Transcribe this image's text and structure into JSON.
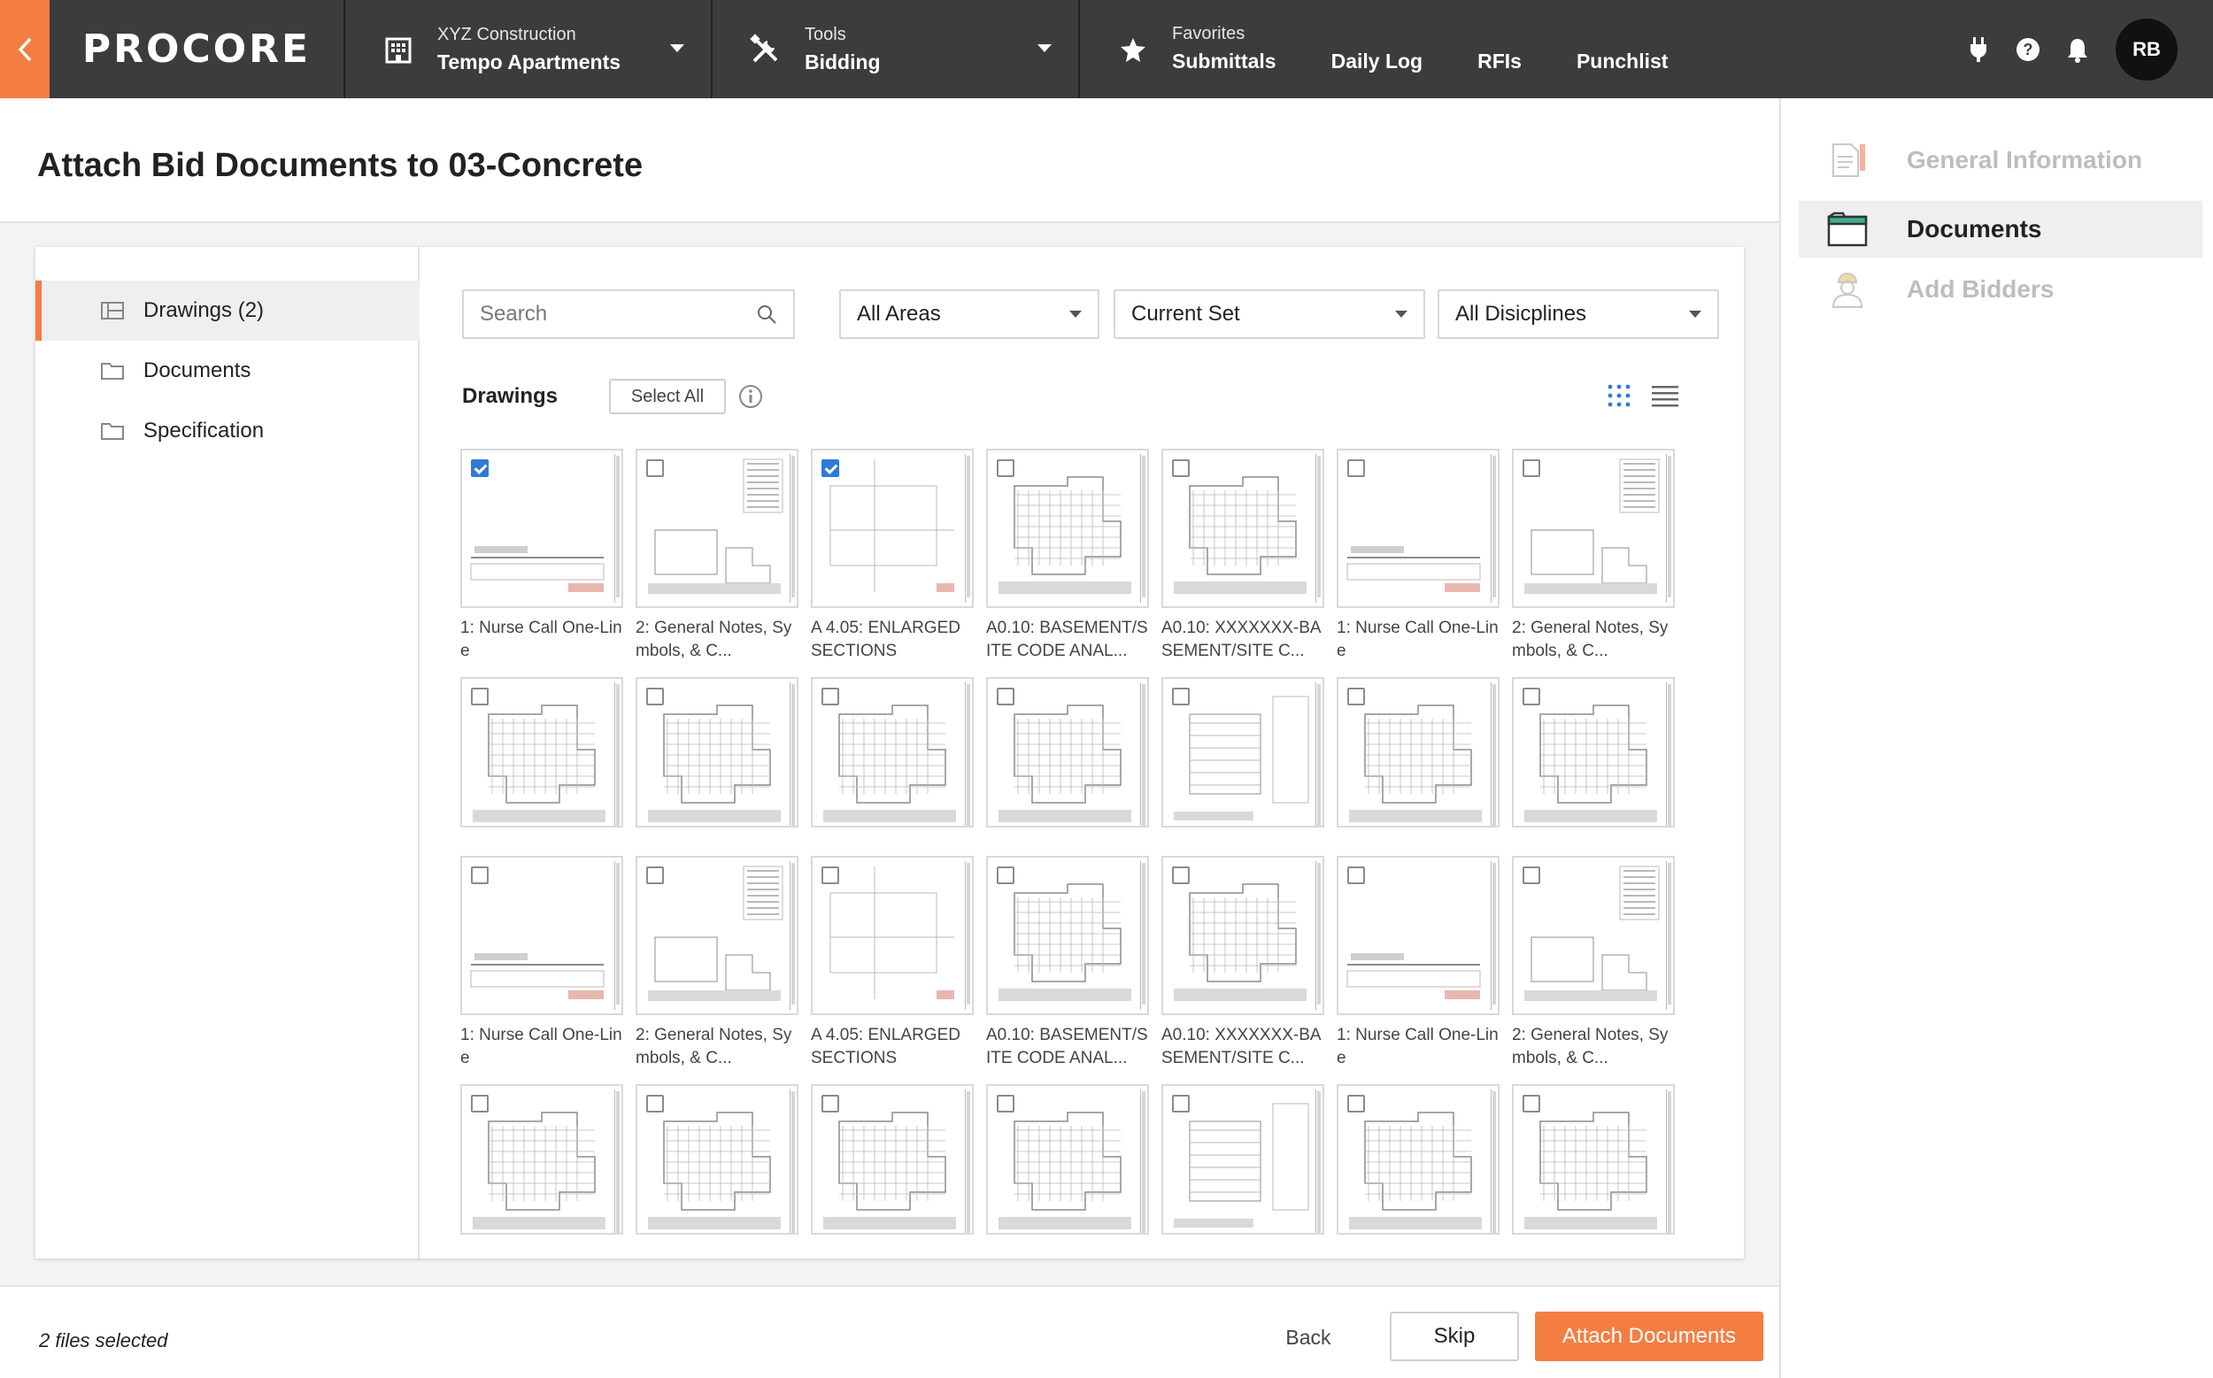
{
  "topbar": {
    "logo": "PROCORE",
    "project": {
      "company": "XYZ Construction",
      "name": "Tempo Apartments"
    },
    "tools": {
      "label": "Tools",
      "current": "Bidding"
    },
    "favorites": {
      "label": "Favorites",
      "links": [
        "Submittals",
        "Daily Log",
        "RFIs",
        "Punchlist"
      ]
    },
    "icons": [
      "plug-icon",
      "help-icon",
      "bell-icon"
    ],
    "avatar": "RB",
    "accent": "#f47e42"
  },
  "page": {
    "title": "Attach Bid Documents to 03-Concrete"
  },
  "sidebar": {
    "items": [
      {
        "label": "Drawings (2)",
        "icon": "drawings-icon",
        "active": true
      },
      {
        "label": "Documents",
        "icon": "folder-icon",
        "active": false
      },
      {
        "label": "Specification",
        "icon": "folder-icon",
        "active": false
      }
    ]
  },
  "filters": {
    "search_placeholder": "Search",
    "areas": "All Areas",
    "set": "Current Set",
    "disciplines": "All Disicplines"
  },
  "drawings": {
    "section_label": "Drawings",
    "select_all": "Select All",
    "items": [
      {
        "caption": "1: Nurse Call One-Line",
        "checked": true,
        "kind": "a"
      },
      {
        "caption": "2: General Notes, Symbols, & C...",
        "checked": false,
        "kind": "b"
      },
      {
        "caption": "A 4.05: ENLARGED SECTIONS",
        "checked": true,
        "kind": "c"
      },
      {
        "caption": "A0.10: BASEMENT/SITE CODE ANAL...",
        "checked": false,
        "kind": "d"
      },
      {
        "caption": "A0.10: XXXXXXX-BASEMENT/SITE C...",
        "checked": false,
        "kind": "d"
      },
      {
        "caption": "1: Nurse Call One-Line",
        "checked": false,
        "kind": "a"
      },
      {
        "caption": "2: General Notes, Symbols, & C...",
        "checked": false,
        "kind": "b"
      },
      {
        "caption": "",
        "checked": false,
        "kind": "d"
      },
      {
        "caption": "",
        "checked": false,
        "kind": "d"
      },
      {
        "caption": "",
        "checked": false,
        "kind": "d"
      },
      {
        "caption": "",
        "checked": false,
        "kind": "d"
      },
      {
        "caption": "",
        "checked": false,
        "kind": "e"
      },
      {
        "caption": "",
        "checked": false,
        "kind": "d"
      },
      {
        "caption": "",
        "checked": false,
        "kind": "d"
      },
      {
        "caption": "1: Nurse Call One-Line",
        "checked": false,
        "kind": "a"
      },
      {
        "caption": "2: General Notes, Symbols, & C...",
        "checked": false,
        "kind": "b"
      },
      {
        "caption": "A 4.05: ENLARGED SECTIONS",
        "checked": false,
        "kind": "c"
      },
      {
        "caption": "A0.10: BASEMENT/SITE CODE ANAL...",
        "checked": false,
        "kind": "d"
      },
      {
        "caption": "A0.10: XXXXXXX-BASEMENT/SITE C...",
        "checked": false,
        "kind": "d"
      },
      {
        "caption": "1: Nurse Call One-Line",
        "checked": false,
        "kind": "a"
      },
      {
        "caption": "2: General Notes, Symbols, & C...",
        "checked": false,
        "kind": "b"
      },
      {
        "caption": "",
        "checked": false,
        "kind": "d"
      },
      {
        "caption": "",
        "checked": false,
        "kind": "d"
      },
      {
        "caption": "",
        "checked": false,
        "kind": "d"
      },
      {
        "caption": "",
        "checked": false,
        "kind": "d"
      },
      {
        "caption": "",
        "checked": false,
        "kind": "e"
      },
      {
        "caption": "",
        "checked": false,
        "kind": "d"
      },
      {
        "caption": "",
        "checked": false,
        "kind": "d"
      }
    ]
  },
  "footer": {
    "status": "2 files selected",
    "back": "Back",
    "skip": "Skip",
    "attach": "Attach Documents"
  },
  "wizard": {
    "steps": [
      {
        "label": "General Information",
        "icon": "document-icon",
        "active": false
      },
      {
        "label": "Documents",
        "icon": "documents-folder-icon",
        "active": true
      },
      {
        "label": "Add Bidders",
        "icon": "bidder-icon",
        "active": false
      }
    ]
  }
}
